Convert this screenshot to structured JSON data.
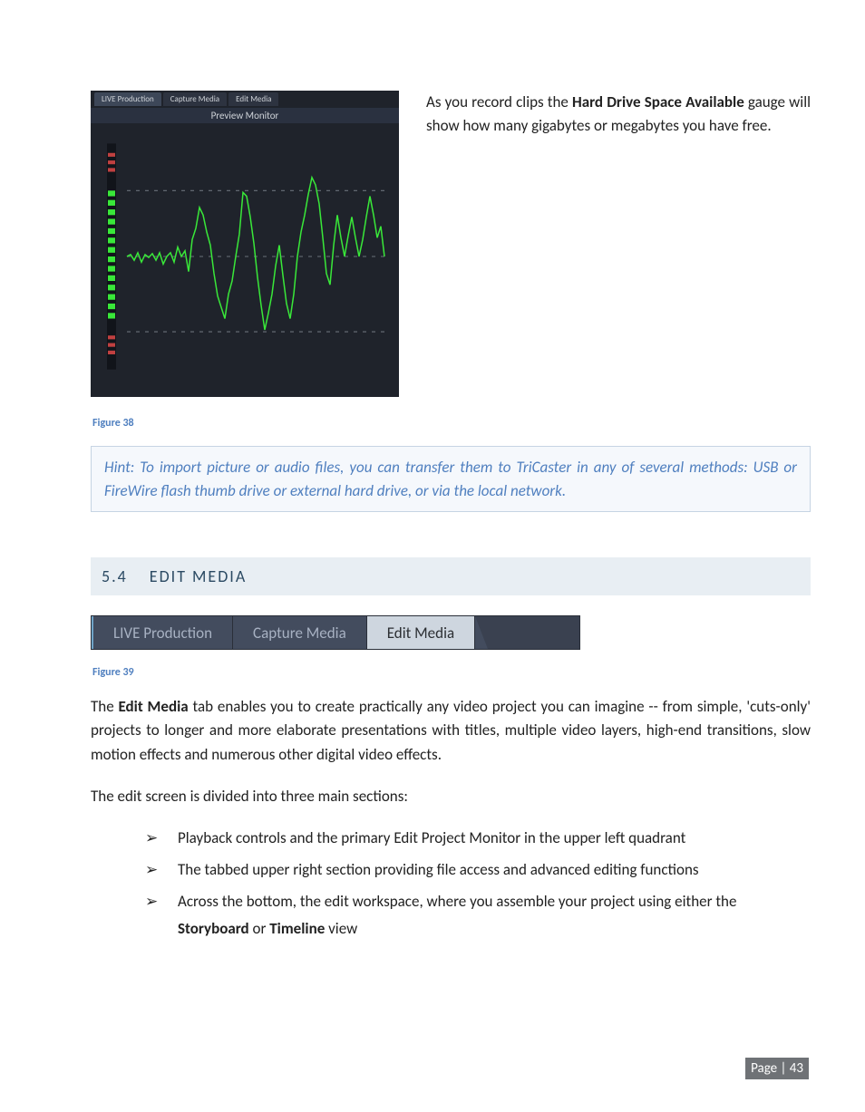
{
  "preview": {
    "tabs": [
      "LIVE Production",
      "Capture Media",
      "Edit Media"
    ],
    "title": "Preview Monitor"
  },
  "descr": {
    "pre": "As you record clips the ",
    "bold": "Hard Drive Space Available",
    "post": " gauge will show how many gigabytes or megabytes you have free."
  },
  "figure38": "Figure 38",
  "hint": "Hint: To import picture or audio files, you can transfer them to TriCaster in any of several methods: USB or FireWire flash thumb drive or external hard drive, or via the local network.",
  "section": {
    "num": "5.4",
    "title": "EDIT MEDIA"
  },
  "tabs_large": {
    "t1": "LIVE Production",
    "t2": "Capture Media",
    "t3": "Edit Media"
  },
  "figure39": "Figure 39",
  "p1": {
    "a": "The ",
    "b": "Edit Media",
    "c": " tab enables you to create practically any video project you can imagine -- from simple, 'cuts-only' projects to longer and more elaborate presentations with titles, multiple video layers, high-end transitions, slow motion effects and numerous other digital video effects."
  },
  "p2": "The edit screen is divided into three main sections:",
  "bullets": {
    "b1": "Playback controls and the primary Edit Project Monitor in the upper left quadrant",
    "b2": "The tabbed upper right section providing file access and advanced editing functions",
    "b3a": "Across the bottom, the edit workspace, where you assemble your project using either the ",
    "b3b": "Storyboard",
    "b3c": " or ",
    "b3d": "Timeline",
    "b3e": " view"
  },
  "footer": "Page | 43",
  "chart_data": {
    "type": "line",
    "title": "Preview Monitor",
    "xlabel": "",
    "ylabel": "",
    "ylim": [
      0,
      100
    ],
    "series": [
      {
        "name": "waveform",
        "values": [
          50,
          50,
          48,
          52,
          47,
          53,
          48,
          51,
          49,
          52,
          48,
          54,
          50,
          48,
          52,
          46,
          50,
          47,
          55,
          60,
          65,
          75,
          70,
          60,
          55,
          45,
          35,
          30,
          25,
          35,
          40,
          50,
          62,
          80,
          78,
          68,
          55,
          40,
          30,
          20,
          28,
          35,
          48,
          55,
          42,
          30,
          25,
          35,
          50,
          62,
          70,
          78,
          85,
          80,
          72,
          58,
          45,
          40,
          55,
          70,
          60,
          50
        ]
      }
    ],
    "gridlines": [
      25,
      50,
      75
    ],
    "vu_left": {
      "segments": 20,
      "lit": 14
    }
  }
}
